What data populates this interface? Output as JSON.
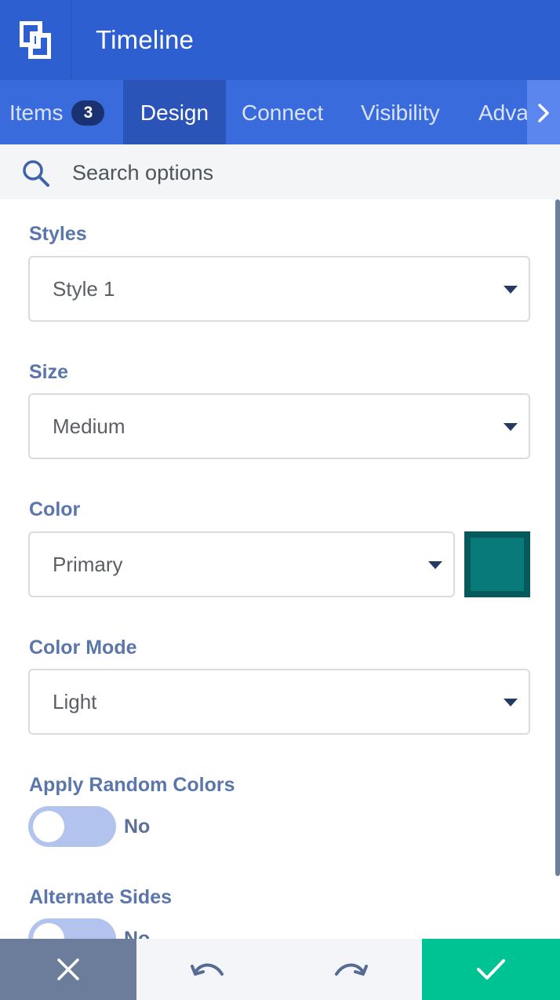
{
  "header": {
    "title": "Timeline"
  },
  "tabs": [
    {
      "label": "Items",
      "badge": "3",
      "active": false
    },
    {
      "label": "Design",
      "active": true
    },
    {
      "label": "Connect",
      "active": false
    },
    {
      "label": "Visibility",
      "active": false
    },
    {
      "label": "Adva",
      "active": false
    }
  ],
  "search": {
    "placeholder": "Search options",
    "value": ""
  },
  "fields": {
    "styles": {
      "label": "Styles",
      "value": "Style 1"
    },
    "size": {
      "label": "Size",
      "value": "Medium"
    },
    "color": {
      "label": "Color",
      "value": "Primary",
      "swatch": "#087a7a"
    },
    "color_mode": {
      "label": "Color Mode",
      "value": "Light"
    },
    "apply_random_colors": {
      "label": "Apply Random Colors",
      "state": "No"
    },
    "alternate_sides": {
      "label": "Alternate Sides",
      "state": "No"
    }
  },
  "colors": {
    "header": "#2d5fd1",
    "tab_bar": "#3a6bdc",
    "active_tab": "#2a54b8",
    "label": "#5a76aa",
    "save": "#00c393",
    "cancel": "#6c7d9b"
  },
  "icons": {
    "logo": "builder-logo-icon",
    "tab_next": "chevron-right-icon",
    "search": "search-icon",
    "select_caret": "caret-down-icon",
    "cancel": "close-icon",
    "undo": "undo-icon",
    "redo": "redo-icon",
    "save": "check-icon"
  }
}
